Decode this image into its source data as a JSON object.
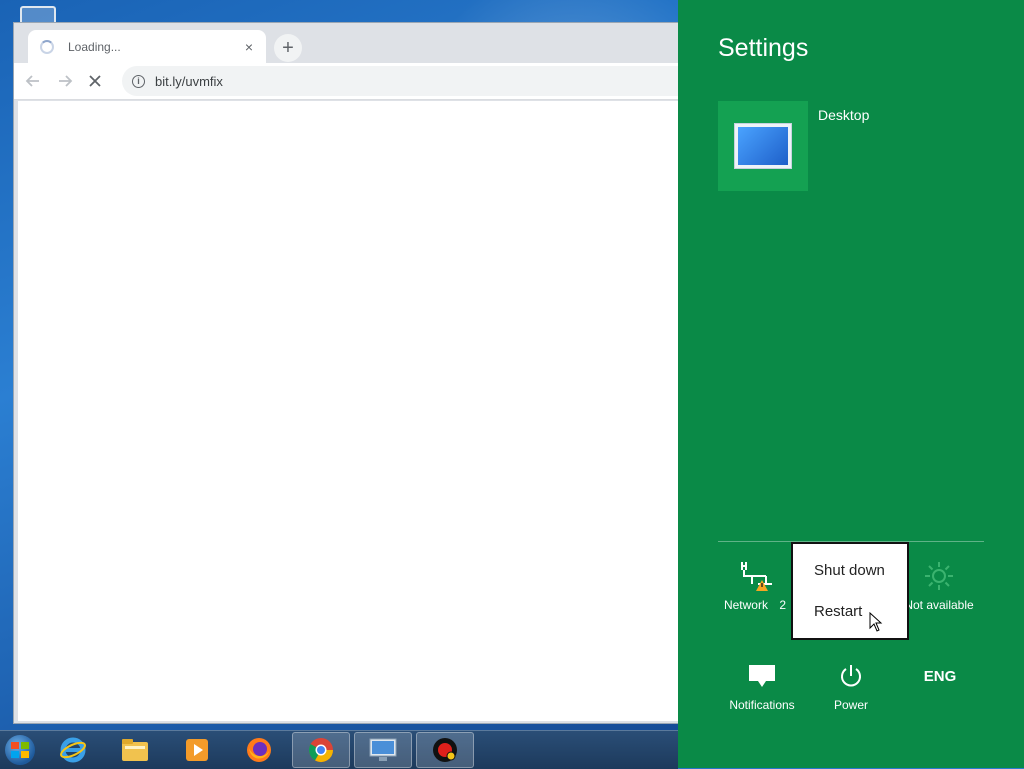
{
  "browser": {
    "tab_title": "Loading...",
    "tab_close": "×",
    "new_tab": "+",
    "url": "bit.ly/uvmfix",
    "back_icon": "arrow-left-icon",
    "forward_icon": "arrow-right-icon",
    "stop_icon": "close-icon",
    "info_icon": "info-icon"
  },
  "settings": {
    "title": "Settings",
    "tile_label": "Desktop",
    "network_label": "Network",
    "network_suffix": "2",
    "brightness_label": "Not available",
    "notifications_label": "Notifications",
    "power_label": "Power",
    "keyboard_label": "ENG"
  },
  "power_menu": {
    "items": [
      "Shut down",
      "Restart"
    ]
  },
  "taskbar": {
    "apps": [
      "internet-explorer",
      "file-explorer",
      "media-player",
      "firefox",
      "chrome",
      "remote-desktop",
      "recorder"
    ]
  },
  "colors": {
    "charms_bg": "#0a8a47",
    "tile_bg": "#14a152"
  }
}
